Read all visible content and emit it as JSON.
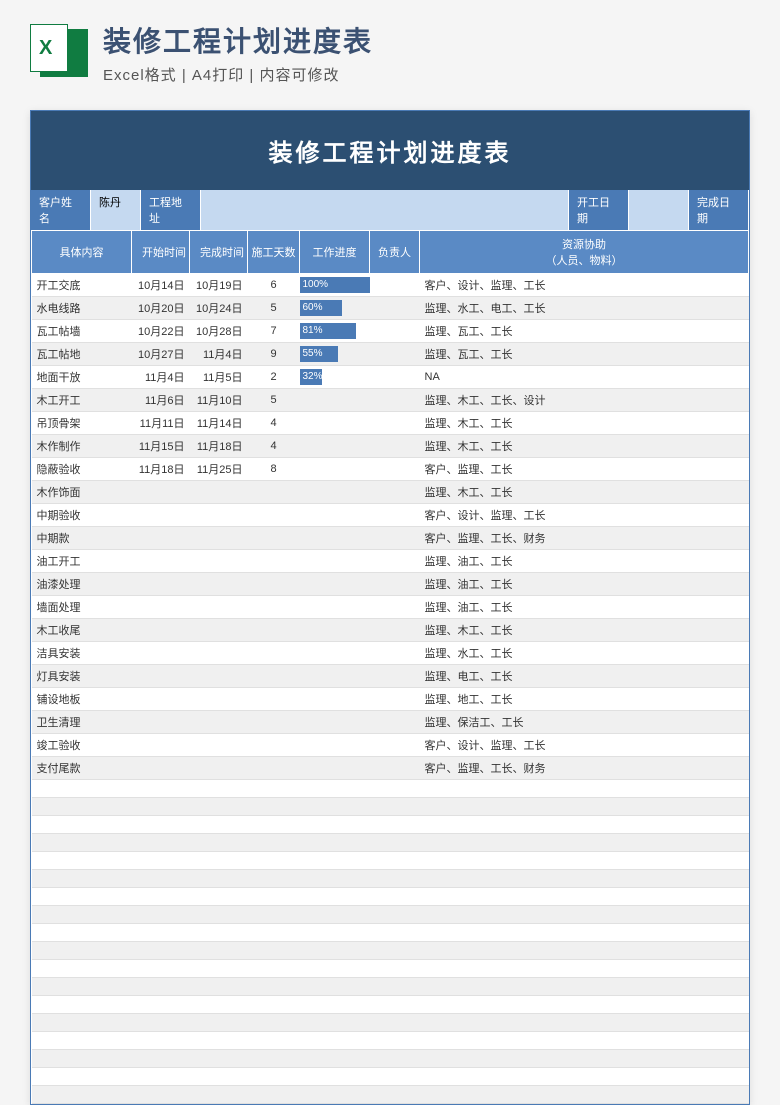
{
  "header": {
    "title": "装修工程计划进度表",
    "subtitle": "Excel格式 | A4打印 | 内容可修改"
  },
  "sheet": {
    "title": "装修工程计划进度表",
    "info": {
      "customer_label": "客户姓名",
      "customer_value": "陈丹",
      "address_label": "工程地址",
      "address_value": "",
      "start_label": "开工日期",
      "start_value": "",
      "finish_label": "完成日期"
    },
    "columns": {
      "content": "具体内容",
      "start": "开始时间",
      "end": "完成时间",
      "days": "施工天数",
      "progress": "工作进度",
      "owner": "负责人",
      "resource": "资源协助\n（人员、物料）"
    },
    "rows": [
      {
        "content": "开工交底",
        "start": "10月14日",
        "end": "10月19日",
        "days": "6",
        "progress": 100,
        "owner": "",
        "resource": "客户、设计、监理、工长"
      },
      {
        "content": "水电线路",
        "start": "10月20日",
        "end": "10月24日",
        "days": "5",
        "progress": 60,
        "owner": "",
        "resource": "监理、水工、电工、工长"
      },
      {
        "content": "瓦工帖墙",
        "start": "10月22日",
        "end": "10月28日",
        "days": "7",
        "progress": 81,
        "owner": "",
        "resource": "监理、瓦工、工长"
      },
      {
        "content": "瓦工帖地",
        "start": "10月27日",
        "end": "11月4日",
        "days": "9",
        "progress": 55,
        "owner": "",
        "resource": "监理、瓦工、工长"
      },
      {
        "content": "地面干放",
        "start": "11月4日",
        "end": "11月5日",
        "days": "2",
        "progress": 32,
        "owner": "",
        "resource": "NA"
      },
      {
        "content": "木工开工",
        "start": "11月6日",
        "end": "11月10日",
        "days": "5",
        "progress": null,
        "owner": "",
        "resource": "监理、木工、工长、设计"
      },
      {
        "content": "吊顶骨架",
        "start": "11月11日",
        "end": "11月14日",
        "days": "4",
        "progress": null,
        "owner": "",
        "resource": "监理、木工、工长"
      },
      {
        "content": "木作制作",
        "start": "11月15日",
        "end": "11月18日",
        "days": "4",
        "progress": null,
        "owner": "",
        "resource": "监理、木工、工长"
      },
      {
        "content": "隐蔽验收",
        "start": "11月18日",
        "end": "11月25日",
        "days": "8",
        "progress": null,
        "owner": "",
        "resource": "客户、监理、工长"
      },
      {
        "content": "木作饰面",
        "start": "",
        "end": "",
        "days": "",
        "progress": null,
        "owner": "",
        "resource": "监理、木工、工长"
      },
      {
        "content": "中期验收",
        "start": "",
        "end": "",
        "days": "",
        "progress": null,
        "owner": "",
        "resource": "客户、设计、监理、工长"
      },
      {
        "content": "中期款",
        "start": "",
        "end": "",
        "days": "",
        "progress": null,
        "owner": "",
        "resource": "客户、监理、工长、财务"
      },
      {
        "content": "油工开工",
        "start": "",
        "end": "",
        "days": "",
        "progress": null,
        "owner": "",
        "resource": "监理、油工、工长"
      },
      {
        "content": "油漆处理",
        "start": "",
        "end": "",
        "days": "",
        "progress": null,
        "owner": "",
        "resource": "监理、油工、工长"
      },
      {
        "content": "墙面处理",
        "start": "",
        "end": "",
        "days": "",
        "progress": null,
        "owner": "",
        "resource": "监理、油工、工长"
      },
      {
        "content": "木工收尾",
        "start": "",
        "end": "",
        "days": "",
        "progress": null,
        "owner": "",
        "resource": "监理、木工、工长"
      },
      {
        "content": "洁具安装",
        "start": "",
        "end": "",
        "days": "",
        "progress": null,
        "owner": "",
        "resource": "监理、水工、工长"
      },
      {
        "content": "灯具安装",
        "start": "",
        "end": "",
        "days": "",
        "progress": null,
        "owner": "",
        "resource": "监理、电工、工长"
      },
      {
        "content": "铺设地板",
        "start": "",
        "end": "",
        "days": "",
        "progress": null,
        "owner": "",
        "resource": "监理、地工、工长"
      },
      {
        "content": "卫生清理",
        "start": "",
        "end": "",
        "days": "",
        "progress": null,
        "owner": "",
        "resource": "监理、保洁工、工长"
      },
      {
        "content": "竣工验收",
        "start": "",
        "end": "",
        "days": "",
        "progress": null,
        "owner": "",
        "resource": "客户、设计、监理、工长"
      },
      {
        "content": "支付尾款",
        "start": "",
        "end": "",
        "days": "",
        "progress": null,
        "owner": "",
        "resource": "客户、监理、工长、财务"
      }
    ],
    "emptyRows": 18
  },
  "chart_data": {
    "type": "table",
    "title": "装修工程计划进度表",
    "columns": [
      "具体内容",
      "开始时间",
      "完成时间",
      "施工天数",
      "工作进度",
      "负责人",
      "资源协助（人员、物料）"
    ],
    "progress_bars": [
      {
        "task": "开工交底",
        "percent": 100
      },
      {
        "task": "水电线路",
        "percent": 60
      },
      {
        "task": "瓦工帖墙",
        "percent": 81
      },
      {
        "task": "瓦工帖地",
        "percent": 55
      },
      {
        "task": "地面干放",
        "percent": 32
      }
    ]
  }
}
